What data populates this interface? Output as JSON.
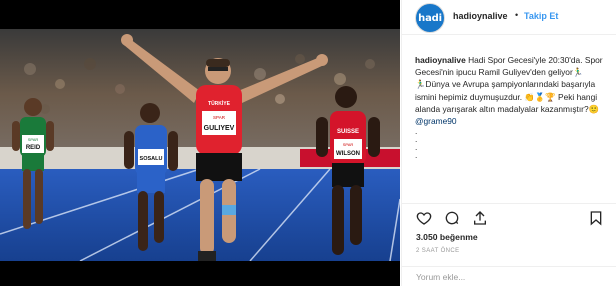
{
  "post": {
    "image_alt": "Ramil Guliyev celebrating victory on the track",
    "bibs": [
      "TÜRKİYE",
      "SPAR",
      "GULIYEV",
      "SPAR",
      "REID",
      "SPAR",
      "SOSALU",
      "SUISSE",
      "SPAR",
      "WILSON"
    ]
  },
  "header": {
    "avatar_text": "hadi",
    "username": "hadioynalive",
    "separator": "•",
    "follow_label": "Takip Et"
  },
  "caption": {
    "username": "hadioynalive",
    "text": "Hadi Spor Gecesi'yle 20:30'da. Spor Gecesi'nin ipucu Ramil Guliyev'den geliyor🏃‍♂️🏃‍♂️Dünya ve Avrupa şampiyonlarındaki başarıyla ismini hepimiz duymuşuzdur. 👏🥇🏆 Peki hangi alanda yarışarak altın madalyalar kazanmıştır?🙂 ",
    "mention": "@grame90",
    "dots": [
      ".",
      ".",
      ".",
      "."
    ]
  },
  "actions": {
    "like": "heart-icon",
    "comment": "comment-icon",
    "share": "share-icon",
    "save": "bookmark-icon"
  },
  "stats": {
    "likes_text": "3.050 beğenme",
    "time_text": "2 SAAT ÖNCE"
  },
  "comment": {
    "placeholder": "Yorum ekle..."
  },
  "colors": {
    "link_blue": "#3897f0",
    "mention_blue": "#003569",
    "brand": "#1877c9",
    "track_blue": "#1f4fa8"
  }
}
